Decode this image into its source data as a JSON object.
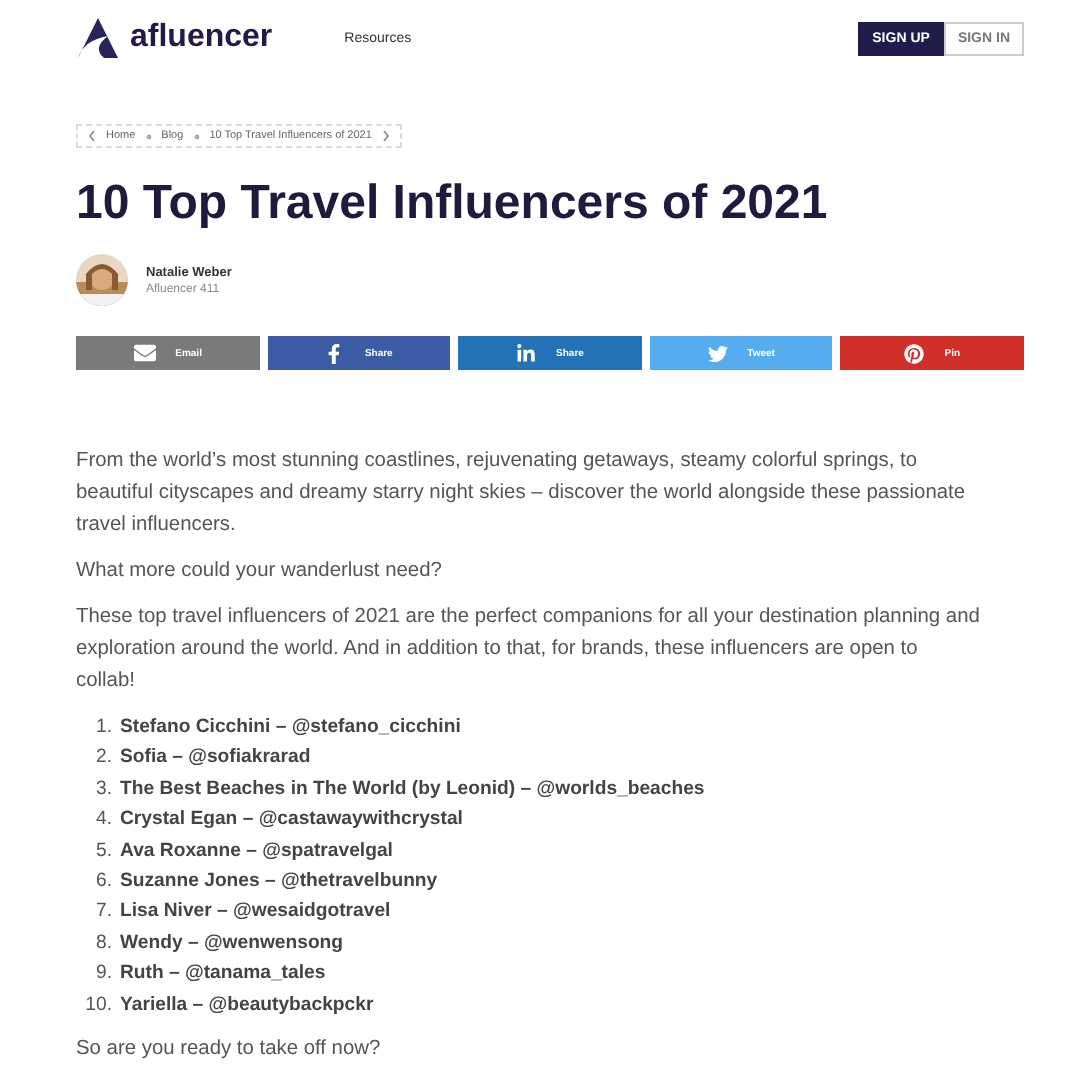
{
  "header": {
    "logo": "afluencer",
    "nav": [
      "Resources"
    ],
    "buttons": [
      {
        "label": "SIGN UP",
        "selected": true
      },
      {
        "label": "SIGN IN",
        "selected": false
      }
    ]
  },
  "breadcrumb": [
    "Home",
    "Blog",
    "10 Top Travel Influencers of 2021"
  ],
  "title": "10 Top Travel Influencers of 2021",
  "author": {
    "name": "Natalie Weber",
    "role": "Afluencer 411"
  },
  "share": [
    {
      "kind": "email",
      "label": "Email",
      "color": "#7a7a7a"
    },
    {
      "kind": "facebook",
      "label": "Share",
      "color": "#3b5ba5"
    },
    {
      "kind": "linkedin",
      "label": "Share",
      "color": "#2372b5"
    },
    {
      "kind": "twitter",
      "label": "Tweet",
      "color": "#55acee"
    },
    {
      "kind": "pinterest",
      "label": "Pin",
      "color": "#d0302a"
    }
  ],
  "intro": [
    "From the world’s most stunning coastlines, rejuvenating getaways, steamy colorful springs, to beautiful cityscapes and dreamy starry night skies – discover the world alongside these passionate travel influencers.",
    "What more could your wanderlust need?",
    "These top travel influencers of 2021 are the perfect companions for all your destination planning and exploration around the world. And in addition to that, for brands, these influencers are open to collab!"
  ],
  "influencers": [
    {
      "number": "1.",
      "text": "Stefano Cicchini – @stefano_cicchini"
    },
    {
      "number": "2.",
      "text": "Sofia – @sofiakrarad"
    },
    {
      "number": "3.",
      "text": "The Best Beaches in The World (by Leonid) – @worlds_beaches"
    },
    {
      "number": "4.",
      "text": "Crystal Egan – @castawaywithcrystal"
    },
    {
      "number": "5.",
      "text": "Ava Roxanne – @spatravelgal"
    },
    {
      "number": "6.",
      "text": "Suzanne Jones – @thetravelbunny"
    },
    {
      "number": "7.",
      "text": "Lisa Niver – @wesaidgotravel"
    },
    {
      "number": "8.",
      "text": "Wendy – @wenwensong"
    },
    {
      "number": "9.",
      "text": "Ruth – @tanama_tales"
    },
    {
      "number": "10.",
      "text": "Yariella – @beautybackpckr"
    }
  ],
  "closing": "So are you ready to take off now?"
}
